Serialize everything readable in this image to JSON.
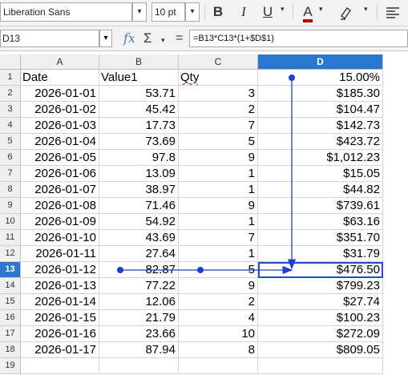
{
  "toolbar": {
    "font_name": "Liberation Sans",
    "font_size": "10 pt",
    "bold_label": "B",
    "italic_label": "I",
    "underline_label": "U",
    "font_color_label": "A",
    "font_color": "#c00000",
    "dropdown_glyph": "▾"
  },
  "formula_bar": {
    "cell_ref": "D13",
    "formula": "=B13*C13*(1+$D$1)",
    "fx_label": "fx",
    "sum_label": "Σ",
    "equals_label": "="
  },
  "sheet": {
    "columns": [
      "A",
      "B",
      "C",
      "D"
    ],
    "selected_column": "D",
    "selected_row": "13",
    "rows": [
      {
        "n": "1",
        "a": "Date",
        "b": "Value1",
        "c": "Qty",
        "d": "15.00%"
      },
      {
        "n": "2",
        "a": "2026-01-01",
        "b": "53.71",
        "c": "3",
        "d": "$185.30"
      },
      {
        "n": "3",
        "a": "2026-01-02",
        "b": "45.42",
        "c": "2",
        "d": "$104.47"
      },
      {
        "n": "4",
        "a": "2026-01-03",
        "b": "17.73",
        "c": "7",
        "d": "$142.73"
      },
      {
        "n": "5",
        "a": "2026-01-04",
        "b": "73.69",
        "c": "5",
        "d": "$423.72"
      },
      {
        "n": "6",
        "a": "2026-01-05",
        "b": "97.8",
        "c": "9",
        "d": "$1,012.23"
      },
      {
        "n": "7",
        "a": "2026-01-06",
        "b": "13.09",
        "c": "1",
        "d": "$15.05"
      },
      {
        "n": "8",
        "a": "2026-01-07",
        "b": "38.97",
        "c": "1",
        "d": "$44.82"
      },
      {
        "n": "9",
        "a": "2026-01-08",
        "b": "71.46",
        "c": "9",
        "d": "$739.61"
      },
      {
        "n": "10",
        "a": "2026-01-09",
        "b": "54.92",
        "c": "1",
        "d": "$63.16"
      },
      {
        "n": "11",
        "a": "2026-01-10",
        "b": "43.69",
        "c": "7",
        "d": "$351.70"
      },
      {
        "n": "12",
        "a": "2026-01-11",
        "b": "27.64",
        "c": "1",
        "d": "$31.79"
      },
      {
        "n": "13",
        "a": "2026-01-12",
        "b": "82.87",
        "c": "5",
        "d": "$476.50"
      },
      {
        "n": "14",
        "a": "2026-01-13",
        "b": "77.22",
        "c": "9",
        "d": "$799.23"
      },
      {
        "n": "15",
        "a": "2026-01-14",
        "b": "12.06",
        "c": "2",
        "d": "$27.74"
      },
      {
        "n": "16",
        "a": "2026-01-15",
        "b": "21.79",
        "c": "4",
        "d": "$100.23"
      },
      {
        "n": "17",
        "a": "2026-01-16",
        "b": "23.66",
        "c": "10",
        "d": "$272.09"
      },
      {
        "n": "18",
        "a": "2026-01-17",
        "b": "87.94",
        "c": "8",
        "d": "$809.05"
      },
      {
        "n": "19",
        "a": "",
        "b": "",
        "c": "",
        "d": ""
      }
    ]
  },
  "colors": {
    "selection": "#2a77d0",
    "trace_arrow": "#1f3fd0"
  }
}
